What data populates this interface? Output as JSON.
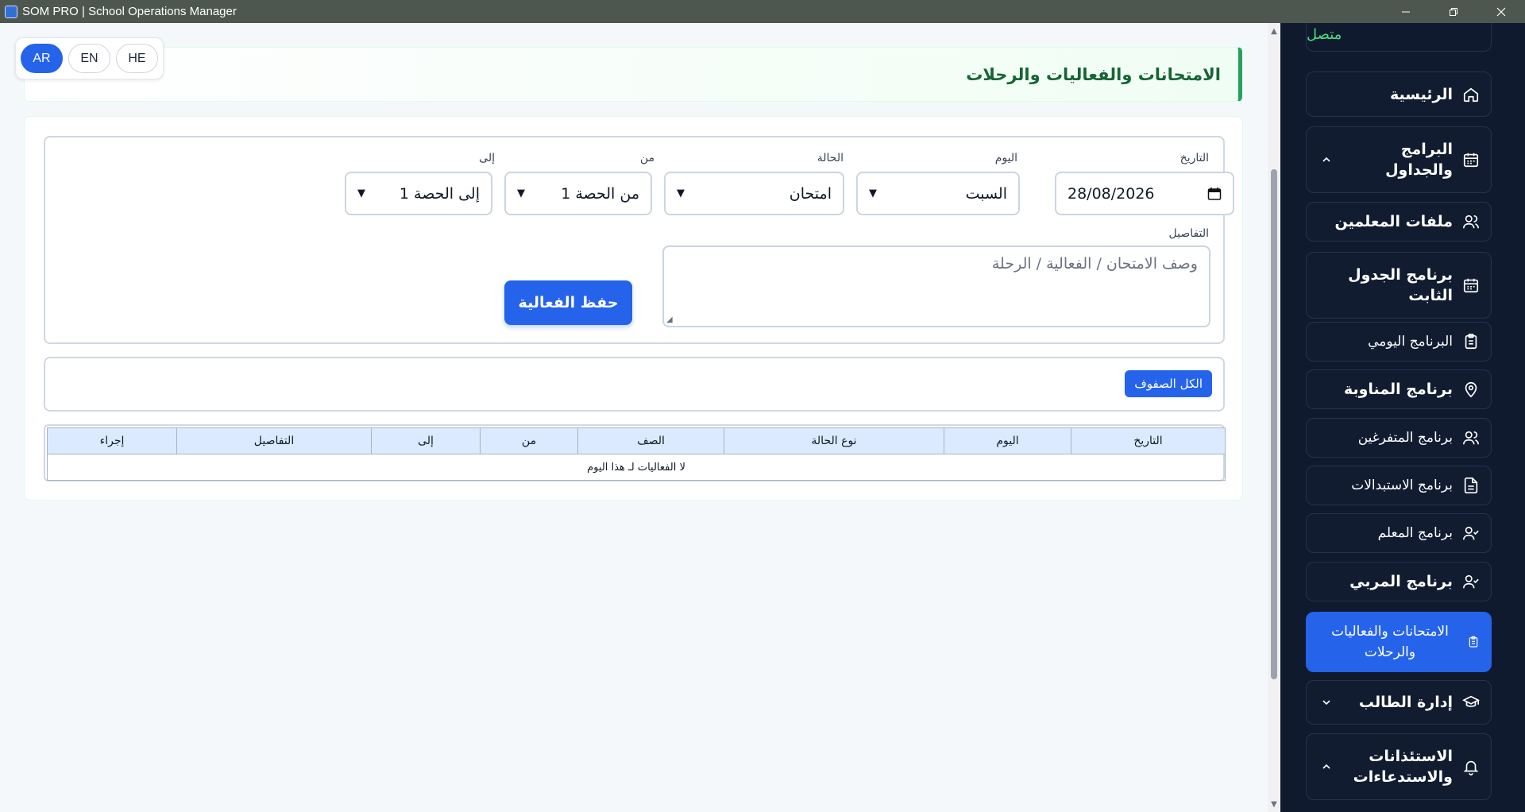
{
  "window": {
    "title": "SOM PRO | School Operations Manager"
  },
  "lang": {
    "ar": "AR",
    "en": "EN",
    "he": "HE",
    "active": "AR"
  },
  "page": {
    "title": "الامتحانات والفعاليات والرحلات"
  },
  "form": {
    "date_label": "التاريخ",
    "date_value": "28/08/2026",
    "day_label": "اليوم",
    "day_value": "السبت",
    "status_label": "الحالة",
    "status_value": "امتحان",
    "from_label": "من",
    "from_value": "من الحصة 1",
    "to_label": "إلى",
    "to_value": "إلى الحصة 1",
    "details_label": "التفاصيل",
    "details_placeholder": "وصف الامتحان / الفعالية / الرحلة",
    "save_label": "حفظ الفعالية"
  },
  "filter": {
    "all_classes_label": "الكل الصفوف"
  },
  "table": {
    "headers": {
      "date": "التاريخ",
      "day": "اليوم",
      "status_type": "نوع الحالة",
      "class": "الصف",
      "from": "من",
      "to": "إلى",
      "details": "التفاصيل",
      "action": "إجراء"
    },
    "empty_message": "لا الفعاليات لـ هذا اليوم"
  },
  "sidebar": {
    "status_text": "متصل",
    "items": [
      {
        "label": "الرئيسية"
      },
      {
        "label": "البرامج والجداول"
      },
      {
        "label": "ملفات المعلمين"
      },
      {
        "label": "برنامج الجدول الثابت"
      },
      {
        "label": "البرنامج اليومي"
      },
      {
        "label": "برنامج المناوبة"
      },
      {
        "label": "برنامج المتفرغين"
      },
      {
        "label": "برنامج الاستبدالات"
      },
      {
        "label": "برنامج المعلم"
      },
      {
        "label": "برنامج المربي"
      },
      {
        "label": "الامتحانات والفعاليات والرحلات"
      },
      {
        "label": "إدارة الطالب"
      },
      {
        "label": "الاستئذانات والاستدعاءات"
      }
    ]
  },
  "colors": {
    "accent": "#2563eb",
    "header_green": "#166534",
    "sidebar_bg": "#0f1a2e"
  }
}
